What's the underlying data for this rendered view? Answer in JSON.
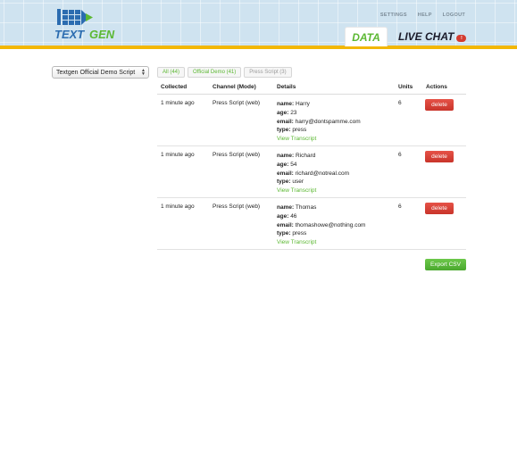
{
  "header": {
    "logo_text": "TEXTGEN",
    "links": [
      "SETTINGS",
      "HELP",
      "LOGOUT"
    ],
    "tabs": [
      {
        "label": "DATA",
        "active": true
      },
      {
        "label": "LIVE CHAT",
        "badge": "!"
      }
    ]
  },
  "script_select": {
    "value": "Textgen Official Demo Script"
  },
  "filters": [
    {
      "label": "All (44)"
    },
    {
      "label": "Official Demo (41)"
    },
    {
      "label": "Press Script (3)"
    }
  ],
  "table": {
    "headers": {
      "collected": "Collected",
      "channel": "Channel (Mode)",
      "details": "Details",
      "units": "Units",
      "actions": "Actions"
    },
    "detail_labels": {
      "name": "name:",
      "age": "age:",
      "email": "email:",
      "type": "type:"
    },
    "rows": [
      {
        "collected": "1 minute ago",
        "channel": "Press Script (web)",
        "name": "Harry",
        "age": "23",
        "email": "harry@dontspamme.com",
        "type": "press",
        "link": "View Transcript",
        "units": "6",
        "action": "delete"
      },
      {
        "collected": "1 minute ago",
        "channel": "Press Script (web)",
        "name": "Richard",
        "age": "54",
        "email": "richard@notreal.com",
        "type": "user",
        "link": "View Transcript",
        "units": "6",
        "action": "delete"
      },
      {
        "collected": "1 minute ago",
        "channel": "Press Script (web)",
        "name": "Thomas",
        "age": "46",
        "email": "thomashowe@nothing.com",
        "type": "press",
        "link": "View Transcript",
        "units": "6",
        "action": "delete"
      }
    ]
  },
  "export_label": "Export CSV",
  "colors": {
    "accent_green": "#5cb833",
    "delete_red": "#d43b2f",
    "header_blue": "#cfe3f0",
    "stripe_yellow": "#f2b705"
  }
}
